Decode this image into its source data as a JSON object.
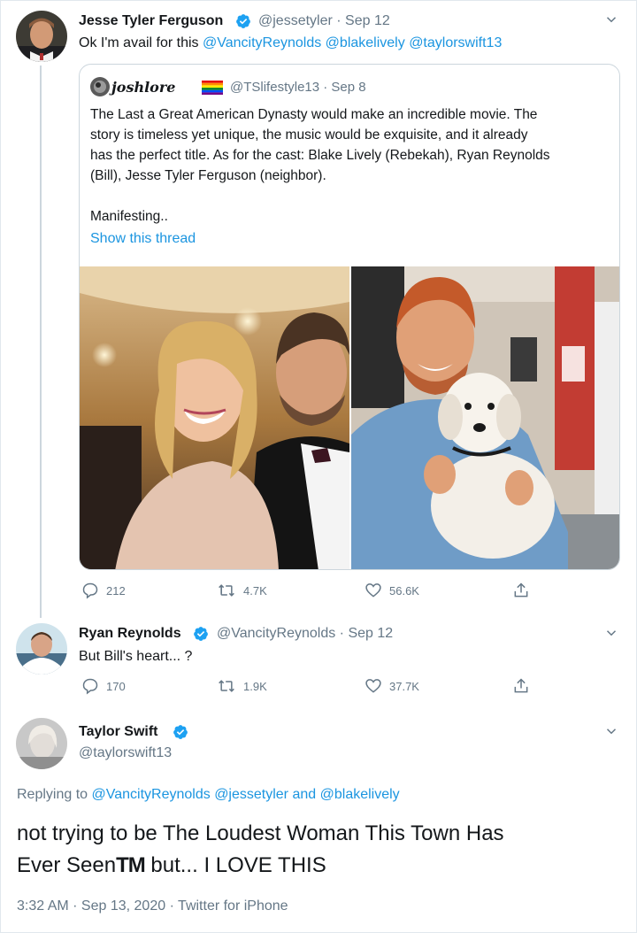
{
  "tweet1": {
    "author": "Jesse Tyler Ferguson",
    "handle_time": "@jessetyler · Sep 12",
    "text_prefix": "Ok I'm avail for this",
    "mentions": [
      "@VancityReynolds",
      "@blakelively",
      "@taylorswift13"
    ],
    "avatar_icon": "jesse-avatar",
    "quote": {
      "author": "joshlore",
      "handle_time": "@TSlifestyle13 · Sep 8",
      "lines": [
        "The Last a Great American Dynasty would make an incredible movie. The",
        "story is timeless yet unique, the music would be exquisite, and it already",
        "has the perfect title. As for the cast: Blake Lively (Rebekah), Ryan Reynolds",
        "(Bill), Jesse Tyler Ferguson (neighbor)."
      ],
      "closing": "Manifesting..",
      "show_thread": "Show this thread"
    },
    "actions": {
      "replies": "212",
      "retweets": "4.7K",
      "likes": "56.6K"
    }
  },
  "tweet2": {
    "author": "Ryan Reynolds",
    "handle_time": "@VancityReynolds · Sep 12",
    "text": "But Bill's heart... ?",
    "actions": {
      "replies": "170",
      "retweets": "1.9K",
      "likes": "37.7K"
    }
  },
  "tweet3": {
    "author": "Taylor Swift",
    "handle": "@taylorswift13",
    "replying_prefix": "Replying to",
    "replying_1": "@VancityReynolds",
    "replying_2": "@jessetyler",
    "replying_and": "and",
    "replying_3": "@blakelively",
    "line1": "not trying to be The Loudest Woman This Town Has",
    "line2_prefix": "Ever Seen",
    "line2_tm": "TM",
    "line2_suffix": " but... I LOVE THIS",
    "meta": "3:32 AM · Sep 13, 2020 · Twitter for iPhone"
  },
  "colors": {
    "link": "#1b95e0",
    "verified": "#1da1f2",
    "muted": "#657786",
    "border": "#ccd6dd"
  }
}
